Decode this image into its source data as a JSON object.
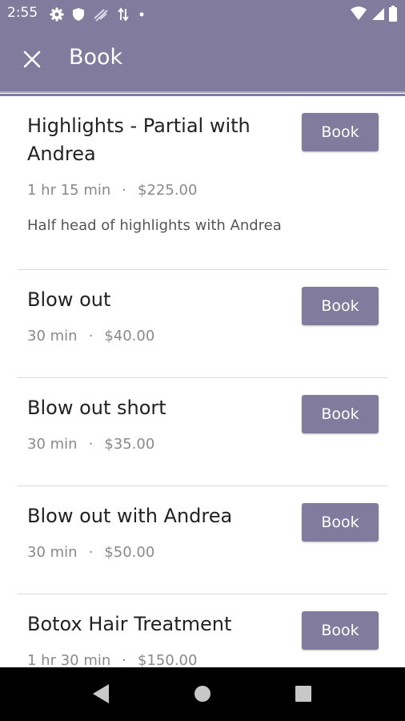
{
  "status_bar": {
    "time": "2:55",
    "left_icons": [
      "gear-icon",
      "shield-icon",
      "wifi-off-icon",
      "data-arrows-icon",
      "dot-icon"
    ],
    "right_icons": [
      "wifi-icon",
      "signal-icon",
      "battery-icon"
    ]
  },
  "app_bar": {
    "title": "Book",
    "close_icon": "close-icon",
    "color": "#817c9d"
  },
  "services": [
    {
      "name": "Highlights - Partial with Andrea",
      "duration": "1 hr 15 min",
      "separator": "·",
      "price": "$225.00",
      "description": "Half head of highlights with Andrea",
      "button_label": "Book"
    },
    {
      "name": "Blow out",
      "duration": "30 min",
      "separator": "·",
      "price": "$40.00",
      "button_label": "Book"
    },
    {
      "name": "Blow out short",
      "duration": "30 min",
      "separator": "·",
      "price": "$35.00",
      "button_label": "Book"
    },
    {
      "name": "Blow out with Andrea",
      "duration": "30 min",
      "separator": "·",
      "price": "$50.00",
      "button_label": "Book"
    },
    {
      "name": "Botox Hair Treatment",
      "duration": "1 hr 30 min",
      "separator": "·",
      "price": "$150.00",
      "button_label": "Book"
    }
  ],
  "nav_bar": {
    "icons": [
      "back-icon",
      "home-icon",
      "recents-icon"
    ]
  }
}
